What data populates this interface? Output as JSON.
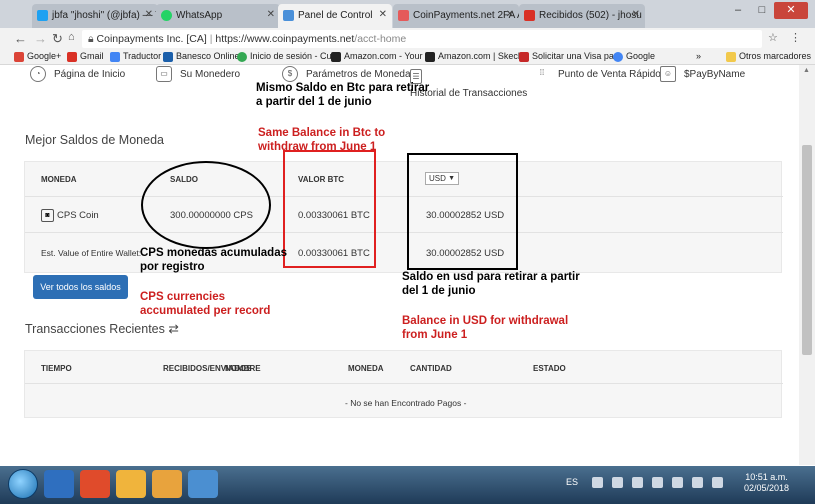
{
  "browser": {
    "tabs": [
      {
        "label": "jbfa \"jhoshi\" (@jbfa) — T",
        "color": "#1da1f2"
      },
      {
        "label": "WhatsApp",
        "color": "#25d366"
      },
      {
        "label": "Panel de Control",
        "color": "#4a90d9"
      },
      {
        "label": "CoinPayments.net 2FA A",
        "color": "#e55a5a"
      },
      {
        "label": "Recibidos (502) - jhosu",
        "color": "#d93025"
      }
    ],
    "window_controls": [
      "–",
      "□",
      "✕"
    ],
    "url_secure": "Coinpayments Inc. [CA]",
    "url_separator": "|",
    "url_host": "https://www.coinpayments.net",
    "url_path": "/acct-home",
    "bookmarks": [
      {
        "label": "Google+",
        "color": "#db4437"
      },
      {
        "label": "Gmail",
        "color": "#d93025"
      },
      {
        "label": "Traductor",
        "color": "#4285f4"
      },
      {
        "label": "Banesco Online",
        "color": "#1b5faa"
      },
      {
        "label": "Inicio de sesión - Cu",
        "color": "#34a853"
      },
      {
        "label": "Amazon.com - Your",
        "color": "#222222"
      },
      {
        "label": "Amazon.com | Skech",
        "color": "#222222"
      },
      {
        "label": "Solicitar una Visa pa",
        "color": "#c62828"
      },
      {
        "label": "Google",
        "color": "#4285f4"
      },
      {
        "label": "»",
        "color": ""
      },
      {
        "label": "Otros marcadores",
        "color": "#f2c94c"
      }
    ]
  },
  "nav": [
    {
      "label": "Página de Inicio",
      "icon": "dashboard-icon",
      "glyph": "◔"
    },
    {
      "label": "Su Monedero",
      "icon": "wallet-icon",
      "glyph": "▭"
    },
    {
      "label": "Parámetros de Moneda",
      "icon": "coin-settings-icon",
      "glyph": "$"
    },
    {
      "label": "Historial de Transacciones",
      "icon": "history-icon",
      "glyph": "☰"
    },
    {
      "label": "Punto de Venta Rápido",
      "icon": "pos-grid-icon",
      "glyph": "⁞⁞"
    },
    {
      "label": "$PayByName",
      "icon": "paybyname-icon",
      "glyph": "☺"
    }
  ],
  "balances": {
    "title": "Mejor Saldos de Moneda",
    "headers": {
      "coin": "MONEDA",
      "balance": "SALDO",
      "btc_value": "VALOR BTC"
    },
    "currency_select": "USD",
    "rows": [
      {
        "coin": "CPS Coin",
        "balance": "300.00000000 CPS",
        "btc": "0.00330061 BTC",
        "usd": "30.00002852 USD"
      },
      {
        "coin": "Est. Value of Entire Wallet:",
        "balance": "",
        "btc": "0.00330061 BTC",
        "usd": "30.00002852 USD"
      }
    ],
    "view_all_button": "Ver todos los saldos"
  },
  "transactions": {
    "title": "Transacciones Recientes",
    "title_icon": "⇄",
    "headers": [
      "TIEMPO",
      "RECIBIDOS/ENVIADOS",
      "NOMBRE",
      "MONEDA",
      "CANTIDAD",
      "ESTADO"
    ],
    "empty": "- No se han Encontrado Pagos -"
  },
  "annotations": {
    "same_balance_es": "Mismo Saldo en Btc para retirar a partir del 1 de junio",
    "same_balance_en": "Same Balance in Btc to withdraw from June 1",
    "cps_es": "CPS monedas acumuladas por registro",
    "cps_en": "CPS currencies accumulated per record",
    "usd_es": "Saldo en usd para retirar a partir del 1 de junio",
    "usd_en": "Balance in USD for withdrawal from June 1",
    "colors": {
      "black": "#000000",
      "red": "#cc1f1f"
    }
  },
  "taskbar": {
    "lang": "ES",
    "time": "10:51 a.m.",
    "date": "02/05/2018",
    "apps": [
      "#2f6fbf",
      "#e04b2b",
      "#f0b43c",
      "#e8a33d",
      "#4b8fd1"
    ]
  }
}
